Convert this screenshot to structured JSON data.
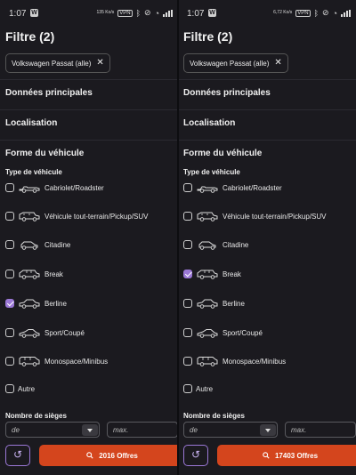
{
  "panels": [
    {
      "status": {
        "time": "1:07",
        "speed": "135 Ko/s",
        "vpn": "VPN"
      },
      "title": "Filtre (2)",
      "chip": {
        "label": "Volkswagen Passat (alle)",
        "remove_glyph": "✕"
      },
      "sections": [
        "Données principales",
        "Localisation",
        "Forme du véhicule"
      ],
      "vehicle_type_label": "Type de véhicule",
      "vehicle_types": [
        {
          "label": "Cabriolet/Roadster",
          "checked": false,
          "icon": "cabriolet-car-icon"
        },
        {
          "label": "Véhicule tout-terrain/Pickup/SUV",
          "checked": false,
          "icon": "suv-car-icon"
        },
        {
          "label": "Citadine",
          "checked": false,
          "icon": "city-car-icon"
        },
        {
          "label": "Break",
          "checked": false,
          "icon": "break-car-icon"
        },
        {
          "label": "Berline",
          "checked": true,
          "icon": "sedan-car-icon"
        },
        {
          "label": "Sport/Coupé",
          "checked": false,
          "icon": "coupe-car-icon"
        },
        {
          "label": "Monospace/Minibus",
          "checked": false,
          "icon": "minibus-car-icon"
        },
        {
          "label": "Autre",
          "checked": false,
          "icon": ""
        }
      ],
      "seats_label": "Nombre de sièges",
      "seats_min_placeholder": "de",
      "seats_max_placeholder": "max.",
      "reset_glyph": "↺",
      "offers_button": "2016 Offres"
    },
    {
      "status": {
        "time": "1:07",
        "speed": "6,72 Ko/s",
        "vpn": "VPN"
      },
      "title": "Filtre (2)",
      "chip": {
        "label": "Volkswagen Passat (alle)",
        "remove_glyph": "✕"
      },
      "sections": [
        "Données principales",
        "Localisation",
        "Forme du véhicule"
      ],
      "vehicle_type_label": "Type de véhicule",
      "vehicle_types": [
        {
          "label": "Cabriolet/Roadster",
          "checked": false,
          "icon": "cabriolet-car-icon"
        },
        {
          "label": "Véhicule tout-terrain/Pickup/SUV",
          "checked": false,
          "icon": "suv-car-icon"
        },
        {
          "label": "Citadine",
          "checked": false,
          "icon": "city-car-icon"
        },
        {
          "label": "Break",
          "checked": true,
          "icon": "break-car-icon"
        },
        {
          "label": "Berline",
          "checked": false,
          "icon": "sedan-car-icon"
        },
        {
          "label": "Sport/Coupé",
          "checked": false,
          "icon": "coupe-car-icon"
        },
        {
          "label": "Monospace/Minibus",
          "checked": false,
          "icon": "minibus-car-icon"
        },
        {
          "label": "Autre",
          "checked": false,
          "icon": ""
        }
      ],
      "seats_label": "Nombre de sièges",
      "seats_min_placeholder": "de",
      "seats_max_placeholder": "max.",
      "reset_glyph": "↺",
      "offers_button": "17403 Offres"
    }
  ],
  "colors": {
    "background": "#1b1a1f",
    "accent": "#9b78d6",
    "cta": "#d4451d",
    "text": "#ececec"
  }
}
